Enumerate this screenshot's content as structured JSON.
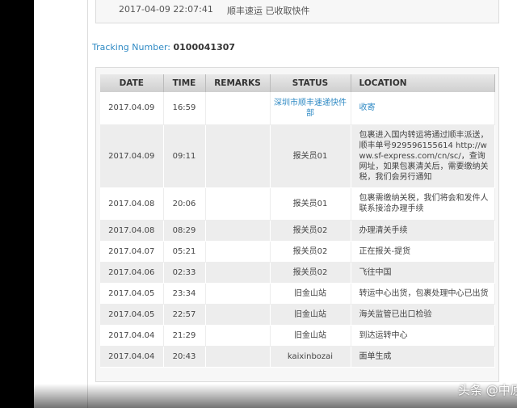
{
  "previous_entry": {
    "datetime": "2017-04-09 22:07:41",
    "status": "顺丰速运 已收取快件"
  },
  "tracking": {
    "label": "Tracking Number:",
    "number": "0100041307"
  },
  "table": {
    "columns": [
      "DATE",
      "TIME",
      "REMARKS",
      "STATUS",
      "LOCATION"
    ],
    "rows": [
      {
        "date": "2017.04.09",
        "time": "16:59",
        "remarks": "",
        "status": "深圳市顺丰速递快件部",
        "location": "收寄",
        "highlight": true
      },
      {
        "date": "2017.04.09",
        "time": "09:11",
        "remarks": "",
        "status": "报关员01",
        "location": "包裹进入国内转运将通过顺丰派送，顺丰单号929596155614 http://www.sf-express.com/cn/sc/，查询网址，如果包裹清关后，需要缴纳关税，我们会另行通知",
        "highlight": false
      },
      {
        "date": "2017.04.08",
        "time": "20:06",
        "remarks": "",
        "status": "报关员01",
        "location": "包裹需缴纳关税，我们将会和发件人联系接洽办理手续",
        "highlight": false
      },
      {
        "date": "2017.04.08",
        "time": "08:29",
        "remarks": "",
        "status": "报关员02",
        "location": "办理清关手续",
        "highlight": false
      },
      {
        "date": "2017.04.07",
        "time": "05:21",
        "remarks": "",
        "status": "报关员02",
        "location": "正在报关-提货",
        "highlight": false
      },
      {
        "date": "2017.04.06",
        "time": "02:33",
        "remarks": "",
        "status": "报关员02",
        "location": "飞往中国",
        "highlight": false
      },
      {
        "date": "2017.04.05",
        "time": "23:34",
        "remarks": "",
        "status": "旧金山站",
        "location": "转运中心出货，包裹处理中心已出货",
        "highlight": false
      },
      {
        "date": "2017.04.05",
        "time": "22:57",
        "remarks": "",
        "status": "旧金山站",
        "location": "海关监管已出口检验",
        "highlight": false
      },
      {
        "date": "2017.04.04",
        "time": "21:29",
        "remarks": "",
        "status": "旧金山站",
        "location": "到达运转中心",
        "highlight": false
      },
      {
        "date": "2017.04.04",
        "time": "20:43",
        "remarks": "",
        "status": "kaixinbozai",
        "location": "面单生成",
        "highlight": false
      }
    ]
  },
  "watermark": "头条 @中原盾",
  "colors": {
    "link_blue": "#2f8ac4",
    "header_gray": "#d8d8d8",
    "stripe_gray": "#ededed"
  }
}
